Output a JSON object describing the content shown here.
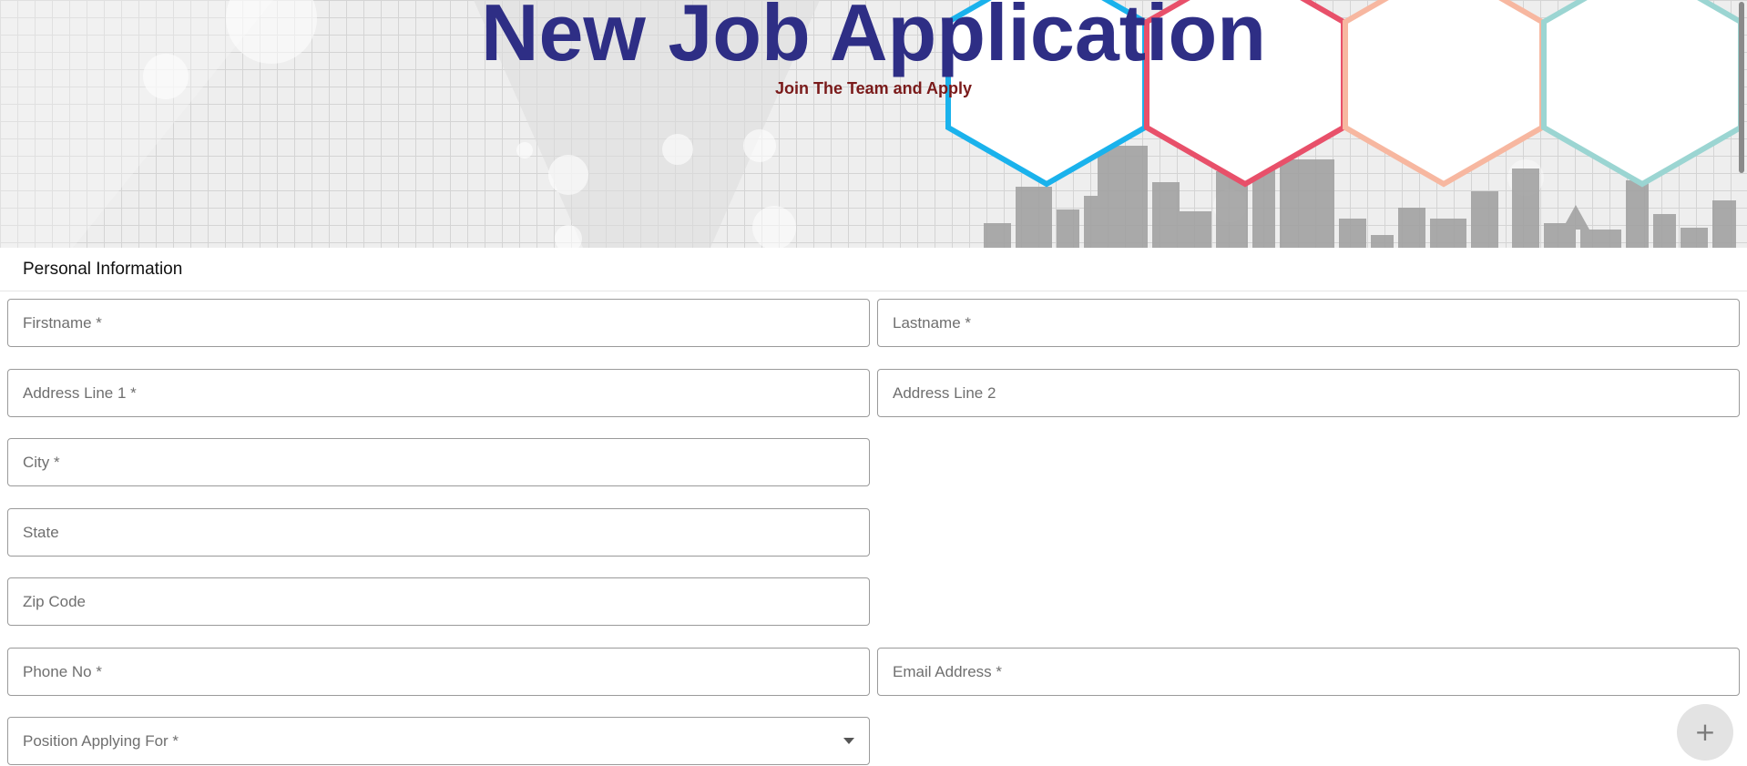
{
  "header": {
    "title": "New Job Application",
    "subtitle": "Join The Team and Apply"
  },
  "section": {
    "title": "Personal Information"
  },
  "form": {
    "firstname": {
      "placeholder": "Firstname *",
      "value": ""
    },
    "lastname": {
      "placeholder": "Lastname *",
      "value": ""
    },
    "address1": {
      "placeholder": "Address Line 1 *",
      "value": ""
    },
    "address2": {
      "placeholder": "Address Line 2",
      "value": ""
    },
    "city": {
      "placeholder": "City *",
      "value": ""
    },
    "state": {
      "placeholder": "State",
      "value": ""
    },
    "zip": {
      "placeholder": "Zip Code",
      "value": ""
    },
    "phone": {
      "placeholder": "Phone No *",
      "value": ""
    },
    "email": {
      "placeholder": "Email Address *",
      "value": ""
    },
    "position": {
      "label": "Position Applying For *"
    }
  },
  "fab": {
    "icon": "plus-icon",
    "glyph": "+"
  },
  "colors": {
    "title": "#2e2e85",
    "subtitle": "#7a1a1a",
    "hex_blue": "#1ab2ec",
    "hex_red": "#e8506a",
    "hex_peach": "#f7b7a0",
    "hex_teal": "#9bd5d2"
  }
}
